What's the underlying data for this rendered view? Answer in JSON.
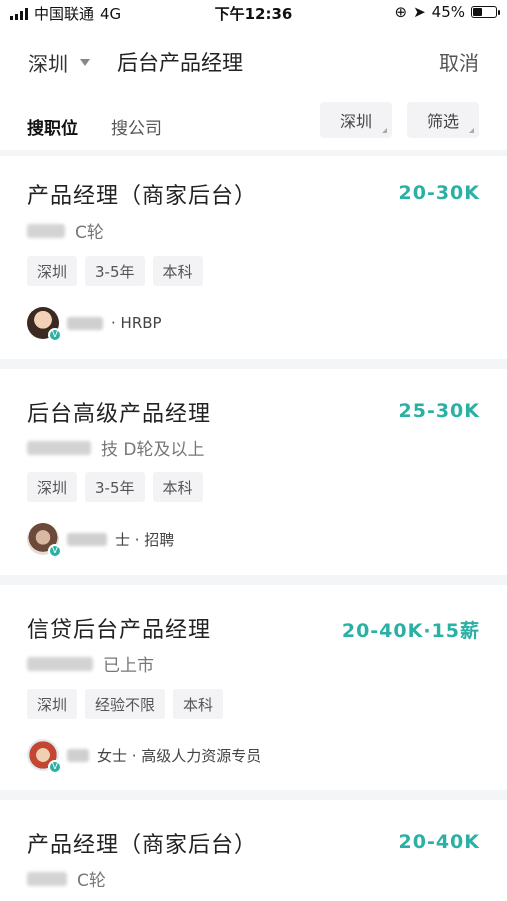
{
  "status_bar": {
    "carrier": "中国联通",
    "network": "4G",
    "time": "下午12:36",
    "battery": "45%",
    "battery_level": 0.45
  },
  "header": {
    "city": "深圳",
    "search_query": "后台产品经理",
    "cancel": "取消"
  },
  "filters": {
    "tab_jobs": "搜职位",
    "tab_companies": "搜公司",
    "city_filter": "深圳",
    "more_filter": "筛选"
  },
  "jobs": [
    {
      "title": "产品经理（商家后台）",
      "salary": "20-30K",
      "company_suffix": "C轮",
      "tags": [
        "深圳",
        "3-5年",
        "本科"
      ],
      "recruiter_suffix": "· HRBP"
    },
    {
      "title": "后台高级产品经理",
      "salary": "25-30K",
      "company_suffix": "技  D轮及以上",
      "tags": [
        "深圳",
        "3-5年",
        "本科"
      ],
      "recruiter_suffix": "士 · 招聘"
    },
    {
      "title": "信贷后台产品经理",
      "salary": "20-40K·15薪",
      "company_suffix": "已上市",
      "tags": [
        "深圳",
        "经验不限",
        "本科"
      ],
      "recruiter_suffix": "女士 · 高级人力资源专员"
    },
    {
      "title": "产品经理（商家后台）",
      "salary": "20-40K",
      "company_suffix": "C轮",
      "tags": [],
      "recruiter_suffix": ""
    }
  ],
  "colors": {
    "accent": "#2ab0a4",
    "background": "#f4f5f7"
  }
}
